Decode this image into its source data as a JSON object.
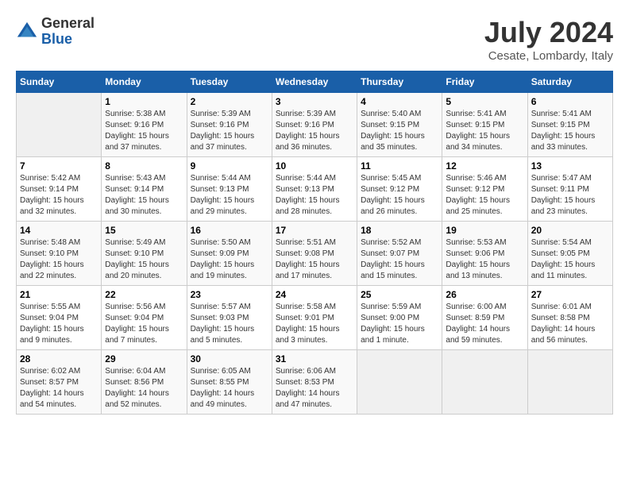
{
  "header": {
    "logo_general": "General",
    "logo_blue": "Blue",
    "title": "July 2024",
    "location": "Cesate, Lombardy, Italy"
  },
  "calendar": {
    "days_of_week": [
      "Sunday",
      "Monday",
      "Tuesday",
      "Wednesday",
      "Thursday",
      "Friday",
      "Saturday"
    ],
    "weeks": [
      [
        {
          "day": "",
          "info": ""
        },
        {
          "day": "1",
          "info": "Sunrise: 5:38 AM\nSunset: 9:16 PM\nDaylight: 15 hours\nand 37 minutes."
        },
        {
          "day": "2",
          "info": "Sunrise: 5:39 AM\nSunset: 9:16 PM\nDaylight: 15 hours\nand 37 minutes."
        },
        {
          "day": "3",
          "info": "Sunrise: 5:39 AM\nSunset: 9:16 PM\nDaylight: 15 hours\nand 36 minutes."
        },
        {
          "day": "4",
          "info": "Sunrise: 5:40 AM\nSunset: 9:15 PM\nDaylight: 15 hours\nand 35 minutes."
        },
        {
          "day": "5",
          "info": "Sunrise: 5:41 AM\nSunset: 9:15 PM\nDaylight: 15 hours\nand 34 minutes."
        },
        {
          "day": "6",
          "info": "Sunrise: 5:41 AM\nSunset: 9:15 PM\nDaylight: 15 hours\nand 33 minutes."
        }
      ],
      [
        {
          "day": "7",
          "info": "Sunrise: 5:42 AM\nSunset: 9:14 PM\nDaylight: 15 hours\nand 32 minutes."
        },
        {
          "day": "8",
          "info": "Sunrise: 5:43 AM\nSunset: 9:14 PM\nDaylight: 15 hours\nand 30 minutes."
        },
        {
          "day": "9",
          "info": "Sunrise: 5:44 AM\nSunset: 9:13 PM\nDaylight: 15 hours\nand 29 minutes."
        },
        {
          "day": "10",
          "info": "Sunrise: 5:44 AM\nSunset: 9:13 PM\nDaylight: 15 hours\nand 28 minutes."
        },
        {
          "day": "11",
          "info": "Sunrise: 5:45 AM\nSunset: 9:12 PM\nDaylight: 15 hours\nand 26 minutes."
        },
        {
          "day": "12",
          "info": "Sunrise: 5:46 AM\nSunset: 9:12 PM\nDaylight: 15 hours\nand 25 minutes."
        },
        {
          "day": "13",
          "info": "Sunrise: 5:47 AM\nSunset: 9:11 PM\nDaylight: 15 hours\nand 23 minutes."
        }
      ],
      [
        {
          "day": "14",
          "info": "Sunrise: 5:48 AM\nSunset: 9:10 PM\nDaylight: 15 hours\nand 22 minutes."
        },
        {
          "day": "15",
          "info": "Sunrise: 5:49 AM\nSunset: 9:10 PM\nDaylight: 15 hours\nand 20 minutes."
        },
        {
          "day": "16",
          "info": "Sunrise: 5:50 AM\nSunset: 9:09 PM\nDaylight: 15 hours\nand 19 minutes."
        },
        {
          "day": "17",
          "info": "Sunrise: 5:51 AM\nSunset: 9:08 PM\nDaylight: 15 hours\nand 17 minutes."
        },
        {
          "day": "18",
          "info": "Sunrise: 5:52 AM\nSunset: 9:07 PM\nDaylight: 15 hours\nand 15 minutes."
        },
        {
          "day": "19",
          "info": "Sunrise: 5:53 AM\nSunset: 9:06 PM\nDaylight: 15 hours\nand 13 minutes."
        },
        {
          "day": "20",
          "info": "Sunrise: 5:54 AM\nSunset: 9:05 PM\nDaylight: 15 hours\nand 11 minutes."
        }
      ],
      [
        {
          "day": "21",
          "info": "Sunrise: 5:55 AM\nSunset: 9:04 PM\nDaylight: 15 hours\nand 9 minutes."
        },
        {
          "day": "22",
          "info": "Sunrise: 5:56 AM\nSunset: 9:04 PM\nDaylight: 15 hours\nand 7 minutes."
        },
        {
          "day": "23",
          "info": "Sunrise: 5:57 AM\nSunset: 9:03 PM\nDaylight: 15 hours\nand 5 minutes."
        },
        {
          "day": "24",
          "info": "Sunrise: 5:58 AM\nSunset: 9:01 PM\nDaylight: 15 hours\nand 3 minutes."
        },
        {
          "day": "25",
          "info": "Sunrise: 5:59 AM\nSunset: 9:00 PM\nDaylight: 15 hours\nand 1 minute."
        },
        {
          "day": "26",
          "info": "Sunrise: 6:00 AM\nSunset: 8:59 PM\nDaylight: 14 hours\nand 59 minutes."
        },
        {
          "day": "27",
          "info": "Sunrise: 6:01 AM\nSunset: 8:58 PM\nDaylight: 14 hours\nand 56 minutes."
        }
      ],
      [
        {
          "day": "28",
          "info": "Sunrise: 6:02 AM\nSunset: 8:57 PM\nDaylight: 14 hours\nand 54 minutes."
        },
        {
          "day": "29",
          "info": "Sunrise: 6:04 AM\nSunset: 8:56 PM\nDaylight: 14 hours\nand 52 minutes."
        },
        {
          "day": "30",
          "info": "Sunrise: 6:05 AM\nSunset: 8:55 PM\nDaylight: 14 hours\nand 49 minutes."
        },
        {
          "day": "31",
          "info": "Sunrise: 6:06 AM\nSunset: 8:53 PM\nDaylight: 14 hours\nand 47 minutes."
        },
        {
          "day": "",
          "info": ""
        },
        {
          "day": "",
          "info": ""
        },
        {
          "day": "",
          "info": ""
        }
      ]
    ]
  }
}
